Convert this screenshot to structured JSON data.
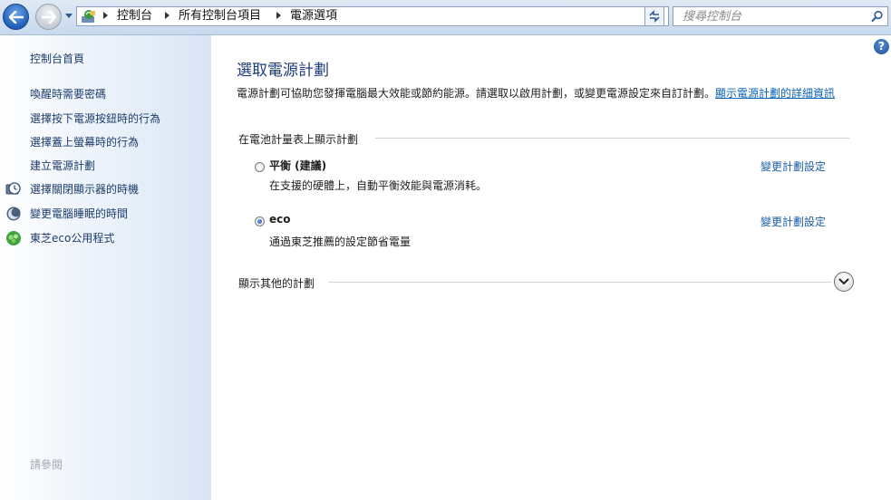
{
  "breadcrumb": {
    "items": [
      "控制台",
      "所有控制台項目",
      "電源選項"
    ]
  },
  "search": {
    "placeholder": "搜尋控制台"
  },
  "sidebar": {
    "home": "控制台首頁",
    "items": [
      {
        "label": "喚醒時需要密碼",
        "icon": ""
      },
      {
        "label": "選擇按下電源按鈕時的行為",
        "icon": ""
      },
      {
        "label": "選擇蓋上螢幕時的行為",
        "icon": ""
      },
      {
        "label": "建立電源計劃",
        "icon": ""
      },
      {
        "label": "選擇關閉顯示器的時機",
        "icon": "clock-monitor-icon"
      },
      {
        "label": "變更電腦睡眠的時間",
        "icon": "moon-icon"
      },
      {
        "label": "東芝eco公用程式",
        "icon": "eco-leaf-icon"
      }
    ],
    "see_also": "請參閱"
  },
  "main": {
    "title": "選取電源計劃",
    "description": "電源計劃可協助您發揮電腦最大效能或節約能源。請選取以啟用計劃，或變更電源設定來自訂計劃。",
    "description_link": "顯示電源計劃的詳細資訊",
    "group_label": "在電池計量表上顯示計劃",
    "plans": [
      {
        "name": "平衡 (建議)",
        "description": "在支援的硬體上，自動平衡效能與電源消耗。",
        "selected": false,
        "link": "變更計劃設定"
      },
      {
        "name": "eco",
        "description": "通過東芝推薦的設定節省電量",
        "selected": true,
        "link": "變更計劃設定"
      }
    ],
    "more_plans_label": "顯示其他的計劃"
  },
  "colors": {
    "link": "#1d5ea8",
    "title": "#1e3c78",
    "sidebar_link": "#1d3d6b"
  }
}
